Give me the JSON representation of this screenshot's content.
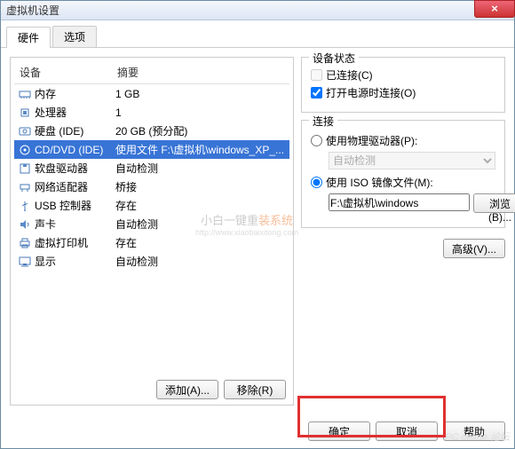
{
  "window": {
    "title": "虚拟机设置"
  },
  "tabs": {
    "hardware": "硬件",
    "options": "选项"
  },
  "headers": {
    "device": "设备",
    "summary": "摘要"
  },
  "devices": [
    {
      "name": "内存",
      "summary": "1 GB",
      "icon": "mem"
    },
    {
      "name": "处理器",
      "summary": "1",
      "icon": "cpu"
    },
    {
      "name": "硬盘 (IDE)",
      "summary": "20 GB (预分配)",
      "icon": "hdd"
    },
    {
      "name": "CD/DVD (IDE)",
      "summary": "使用文件 F:\\虚拟机\\windows_XP_...",
      "icon": "cd",
      "selected": true
    },
    {
      "name": "软盘驱动器",
      "summary": "自动检测",
      "icon": "floppy"
    },
    {
      "name": "网络适配器",
      "summary": "桥接",
      "icon": "net"
    },
    {
      "name": "USB 控制器",
      "summary": "存在",
      "icon": "usb"
    },
    {
      "name": "声卡",
      "summary": "自动检测",
      "icon": "sound"
    },
    {
      "name": "虚拟打印机",
      "summary": "存在",
      "icon": "printer"
    },
    {
      "name": "显示",
      "summary": "自动检测",
      "icon": "display"
    }
  ],
  "status": {
    "title": "设备状态",
    "connected": "已连接(C)",
    "poweron": "打开电源时连接(O)",
    "connected_checked": false,
    "poweron_checked": true
  },
  "connection": {
    "title": "连接",
    "physical": "使用物理驱动器(P):",
    "physical_value": "自动检测",
    "iso": "使用 ISO 镜像文件(M):",
    "iso_value": "F:\\虚拟机\\windows",
    "browse": "浏览(B)...",
    "selected": "iso"
  },
  "advanced": "高级(V)...",
  "buttons": {
    "add": "添加(A)...",
    "remove": "移除(R)",
    "ok": "确定",
    "cancel": "取消",
    "help": "帮助"
  },
  "watermark": {
    "l1a": "小白一键重",
    "l1b": "装系统",
    "l2": "http://www.xiaobaixitong.com"
  },
  "corner": "PC online  论坛"
}
